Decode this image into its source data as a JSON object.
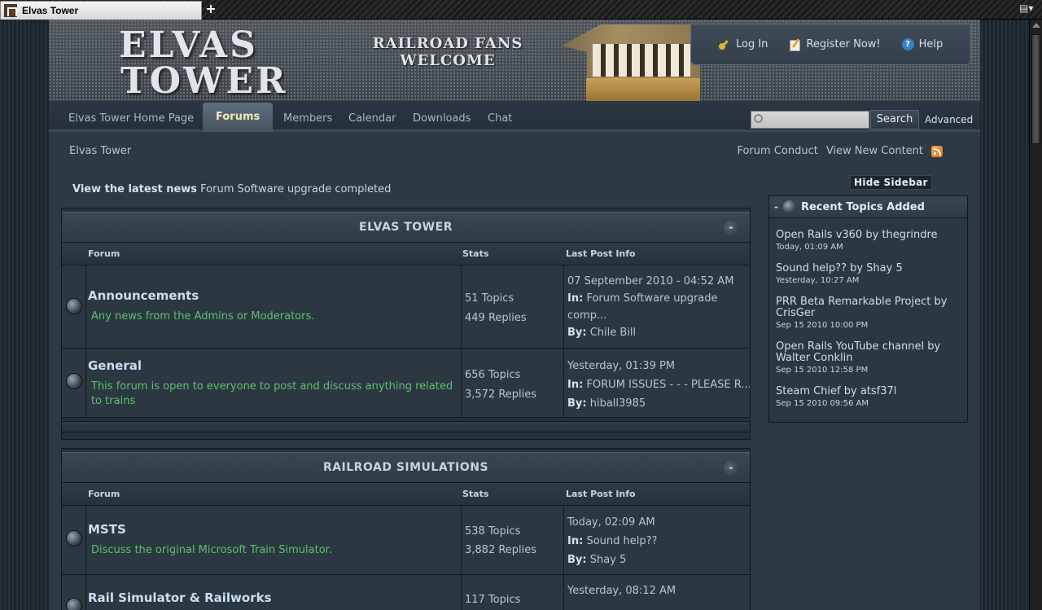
{
  "browser": {
    "tab_title": "Elvas Tower",
    "new_tab": "+"
  },
  "header": {
    "logo_line1": "ELVAS",
    "logo_line2": "TOWER",
    "tagline_line1": "RAILROAD FANS",
    "tagline_line2": "WELCOME",
    "login_label": "Log In",
    "register_label": "Register Now!",
    "help_label": "Help"
  },
  "nav": {
    "items": [
      "Elvas Tower Home Page",
      "Forums",
      "Members",
      "Calendar",
      "Downloads",
      "Chat"
    ],
    "active": "Forums",
    "search_placeholder": "",
    "search_button": "Search",
    "advanced_label": "Advanced"
  },
  "breadcrumb": "Elvas Tower",
  "subnav": {
    "forum_conduct": "Forum Conduct",
    "view_new_content": "View New Content"
  },
  "news": {
    "label": "View the latest news",
    "text": "Forum Software upgrade completed"
  },
  "columns": {
    "forum": "Forum",
    "stats": "Stats",
    "last_post": "Last Post Info"
  },
  "categories": [
    {
      "title": "ELVAS TOWER",
      "collapse": "-",
      "forums": [
        {
          "name": "Announcements",
          "description": "Any news from the Admins or Moderators.",
          "topics": "51 Topics",
          "replies": "449 Replies",
          "last_date": "07 September 2010 - 04:52 AM",
          "in_label": "In:",
          "in_topic": "Forum Software upgrade",
          "in_topic_2": "comp...",
          "by_label": "By:",
          "by_user": "Chile Bill"
        },
        {
          "name": "General",
          "description": "This forum is open to everyone to post and discuss anything related",
          "description_2": "to trains",
          "topics": "656 Topics",
          "replies": "3,572 Replies",
          "last_date": "Yesterday, 01:39 PM",
          "in_label": "In:",
          "in_topic": "FORUM ISSUES - - - PLEASE R...",
          "by_label": "By:",
          "by_user": "hiball3985"
        }
      ]
    },
    {
      "title": "RAILROAD SIMULATIONS",
      "collapse": "-",
      "forums": [
        {
          "name": "MSTS",
          "description": "Discuss the original Microsoft Train Simulator.",
          "topics": "538 Topics",
          "replies": "3,882 Replies",
          "last_date": "Today, 02:09 AM",
          "in_label": "In:",
          "in_topic": "Sound help??",
          "by_label": "By:",
          "by_user": "Shay 5"
        },
        {
          "name": "Rail Simulator & Railworks",
          "topics": "117 Topics",
          "last_date": "Yesterday, 08:12 AM"
        }
      ]
    }
  ],
  "sidebar": {
    "hide_label": "Hide Sidebar",
    "collapse": "-",
    "title": "Recent Topics Added",
    "topics": [
      {
        "title": "Open Rails v360 by thegrindre",
        "date": "Today, 01:09 AM"
      },
      {
        "title": "Sound help?? by Shay 5",
        "date": "Yesterday, 10:27 AM"
      },
      {
        "title": "PRR Beta Remarkable Project by CrisGer",
        "date": "Sep 15 2010 10:00 PM"
      },
      {
        "title": "Open Rails YouTube channel by Walter Conklin",
        "date": "Sep 15 2010 12:58 PM"
      },
      {
        "title": "Steam Chief by atsf37l",
        "date": "Sep 15 2010 09:56 AM"
      }
    ]
  },
  "colors": {
    "link_blue": "#c9dff2",
    "description_green": "#5fbf6e",
    "active_tab_text": "#f3e8b5"
  },
  "icons": {
    "login": "key-icon",
    "register": "pencil-icon",
    "help": "help-icon",
    "feed": "rss-icon",
    "forum_state": "forum-state-icon"
  }
}
